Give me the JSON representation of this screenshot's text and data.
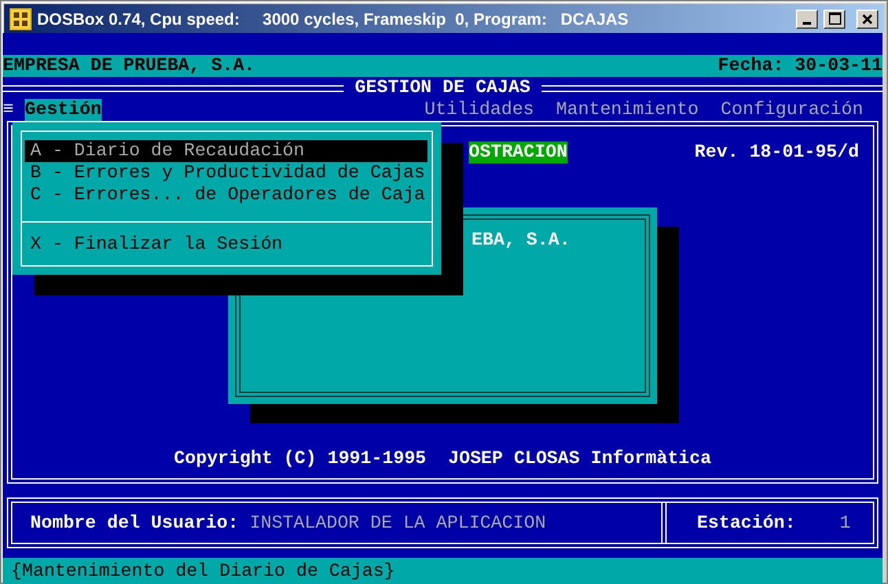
{
  "window": {
    "title": "DOSBox 0.74, Cpu speed:     3000 cycles, Frameskip  0, Program:   DCAJAS"
  },
  "header": {
    "company": "EMPRESA DE PRUEBA, S.A.",
    "date": "Fecha: 30-03-11",
    "title": "GESTION DE CAJAS"
  },
  "menu_bar": {
    "system_glyph": "≡",
    "items": [
      {
        "label": "Gestión",
        "selected": true
      },
      {
        "label": "Utilidades",
        "selected": false
      },
      {
        "label": "Mantenimiento",
        "selected": false
      },
      {
        "label": "Configuración",
        "selected": false
      }
    ]
  },
  "dropdown": {
    "items": [
      {
        "kind": "item",
        "label": "A - Diario de Recaudación",
        "selected": true
      },
      {
        "kind": "item",
        "label": "B - Errores y Productividad de Cajas",
        "selected": false
      },
      {
        "kind": "item",
        "label": "C - Errores... de Operadores de Caja",
        "selected": false
      },
      {
        "kind": "separator"
      },
      {
        "kind": "item",
        "label": "X - Finalizar la Sesión",
        "selected": false
      }
    ]
  },
  "main": {
    "mode_badge": "OSTRACION",
    "revision": "Rev. 18-01-95/d",
    "dialog_text": "EBA, S.A.",
    "copyright": "Copyright (C) 1991-1995  JOSEP CLOSAS Informàtica"
  },
  "user_panel": {
    "user_label": "Nombre del Usuario:",
    "user_value": "INSTALADOR DE LA APLICACION",
    "station_label": "Estación:",
    "station_value": "1"
  },
  "status_bar": {
    "text": "{Mantenimiento del Diario de Cajas}"
  }
}
